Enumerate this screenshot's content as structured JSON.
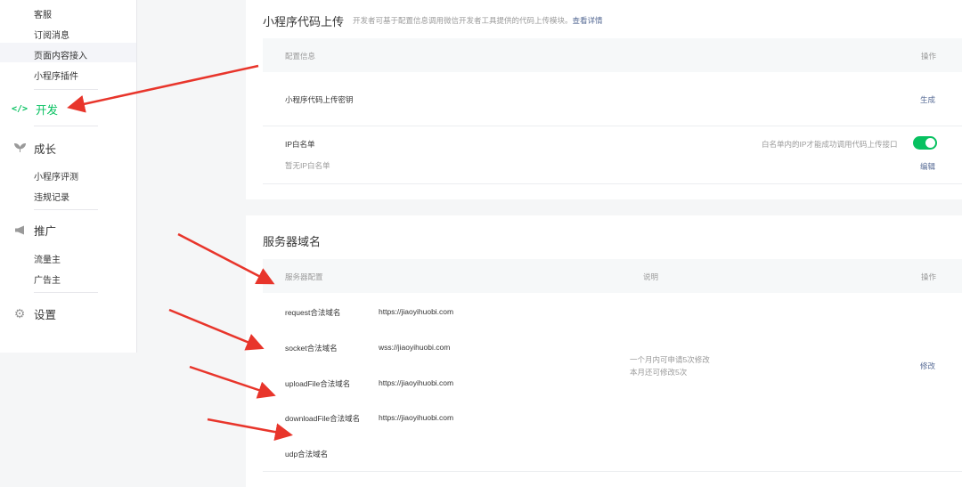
{
  "sidebar": {
    "group1": [
      "客服",
      "订阅消息",
      "页面内容接入",
      "小程序插件"
    ],
    "dev": {
      "icon": "code-icon",
      "label": "开发"
    },
    "growth": {
      "icon": "leaf-icon",
      "label": "成长",
      "items": [
        "小程序评测",
        "违规记录"
      ]
    },
    "promo": {
      "icon": "megaphone-icon",
      "label": "推广",
      "items": [
        "流量主",
        "广告主"
      ]
    },
    "settings": {
      "icon": "gear-icon",
      "label": "设置"
    }
  },
  "upload": {
    "title": "小程序代码上传",
    "desc": "开发者可基于配置信息调用微信开发者工具提供的代码上传模块。",
    "desc_link": "查看详情",
    "header_config": "配置信息",
    "header_action": "操作",
    "secret_label": "小程序代码上传密钥",
    "secret_action": "生成",
    "ip_label": "IP白名单",
    "ip_empty": "暂无IP白名单",
    "ip_toggle_desc": "白名单内的IP才能成功调用代码上传接口",
    "ip_action": "编辑"
  },
  "domain": {
    "title": "服务器域名",
    "header_config": "服务器配置",
    "header_desc": "说明",
    "header_action": "操作",
    "rows": [
      {
        "label": "request合法域名",
        "value": "https://jiaoyihuobi.com"
      },
      {
        "label": "socket合法域名",
        "value": "wss://jiaoyihuobi.com"
      },
      {
        "label": "uploadFile合法域名",
        "value": "https://jiaoyihuobi.com"
      },
      {
        "label": "downloadFile合法域名",
        "value": "https://jiaoyihuobi.com"
      },
      {
        "label": "udp合法域名",
        "value": ""
      }
    ],
    "note1": "一个月内可申请5次修改",
    "note2": "本月还可修改5次",
    "action": "修改"
  },
  "colors": {
    "accent": "#07c160",
    "link": "#576b95",
    "arrow": "#e8352b"
  }
}
